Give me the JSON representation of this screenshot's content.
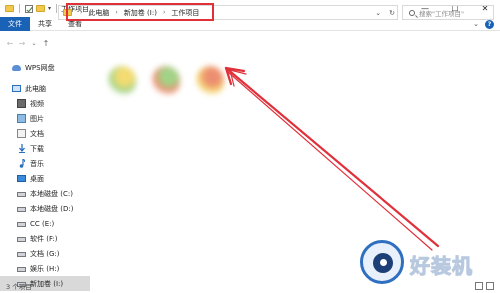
{
  "window": {
    "title": "工作项目",
    "minimize": "—",
    "maximize": "☐",
    "close": "✕"
  },
  "ribbon": {
    "tabs": [
      "文件",
      "共享",
      "查看"
    ],
    "collapse": "⌄",
    "help": "?"
  },
  "nav": {
    "back": "←",
    "forward": "→",
    "recent": "⌄",
    "up": "↑"
  },
  "address": {
    "breadcrumb": [
      "此电脑",
      "新加卷 (I:)",
      "工作项目"
    ],
    "separator": "›",
    "dropdown": "⌄",
    "refresh": "↻"
  },
  "search": {
    "placeholder": "搜索\"工作项目\""
  },
  "sidebar": {
    "items": [
      {
        "label": "WPS网盘",
        "icon": "cloud-icon"
      },
      {
        "label": "此电脑",
        "icon": "computer-icon"
      },
      {
        "label": "视频",
        "icon": "video-folder-icon"
      },
      {
        "label": "图片",
        "icon": "pictures-folder-icon"
      },
      {
        "label": "文档",
        "icon": "documents-folder-icon"
      },
      {
        "label": "下载",
        "icon": "download-arrow-icon"
      },
      {
        "label": "音乐",
        "icon": "music-note-icon"
      },
      {
        "label": "桌面",
        "icon": "desktop-folder-icon"
      },
      {
        "label": "本地磁盘 (C:)",
        "icon": "drive-icon"
      },
      {
        "label": "本地磁盘 (D:)",
        "icon": "drive-icon"
      },
      {
        "label": "CC (E:)",
        "icon": "drive-icon"
      },
      {
        "label": "软件 (F:)",
        "icon": "drive-icon"
      },
      {
        "label": "文档 (G:)",
        "icon": "drive-icon"
      },
      {
        "label": "娱乐 (H:)",
        "icon": "drive-icon"
      },
      {
        "label": "新加卷 (I:)",
        "icon": "drive-icon",
        "selected": true
      }
    ]
  },
  "files": [
    {
      "color": "#8cc86a",
      "accent": "#f2d34f"
    },
    {
      "color": "#e8734d",
      "accent": "#8cc86a"
    },
    {
      "color": "#f2c94c",
      "accent": "#e8734d"
    }
  ],
  "status": {
    "count": "3 个项目"
  },
  "annotation": {
    "color": "#e0303a"
  },
  "watermark": {
    "text": "好装机"
  }
}
